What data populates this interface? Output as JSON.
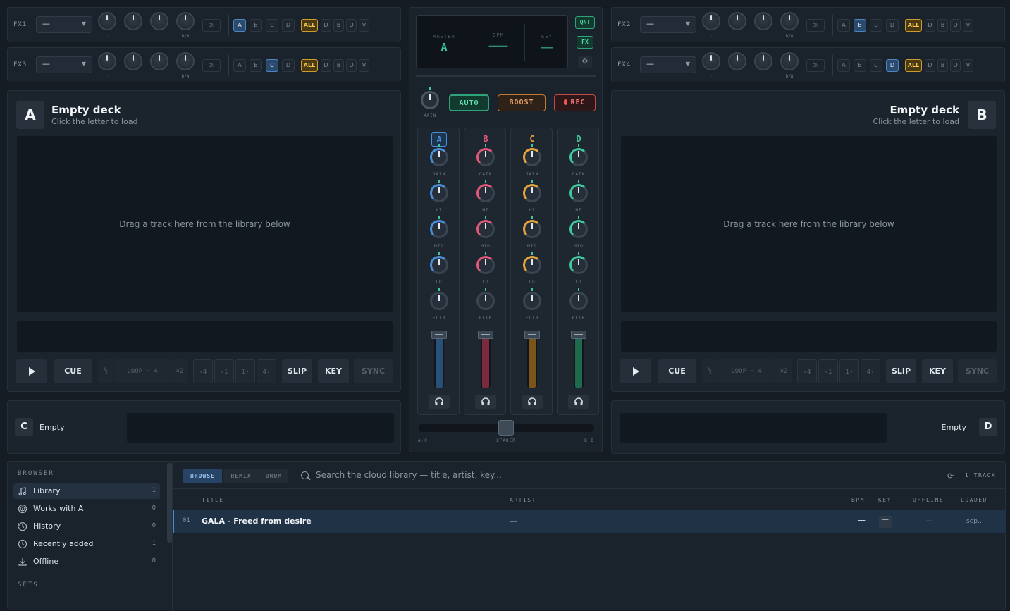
{
  "fx_units": [
    {
      "name": "FX1",
      "effect": "—",
      "mix_label": "D/W",
      "on_label": "ON",
      "channels": [
        "A",
        "B",
        "C",
        "D"
      ],
      "selected": "A",
      "all_label": "ALL",
      "outputs": [
        "D",
        "B",
        "O",
        "V"
      ]
    },
    {
      "name": "FX3",
      "effect": "—",
      "mix_label": "D/W",
      "on_label": "ON",
      "channels": [
        "A",
        "B",
        "C",
        "D"
      ],
      "selected": "C",
      "all_label": "ALL",
      "outputs": [
        "D",
        "B",
        "O",
        "V"
      ]
    },
    {
      "name": "FX2",
      "effect": "—",
      "mix_label": "D/W",
      "on_label": "ON",
      "channels": [
        "A",
        "B",
        "C",
        "D"
      ],
      "selected": "B",
      "all_label": "ALL",
      "outputs": [
        "D",
        "B",
        "O",
        "V"
      ]
    },
    {
      "name": "FX4",
      "effect": "—",
      "mix_label": "D/W",
      "on_label": "ON",
      "channels": [
        "A",
        "B",
        "C",
        "D"
      ],
      "selected": "D",
      "all_label": "ALL",
      "outputs": [
        "D",
        "B",
        "O",
        "V"
      ]
    }
  ],
  "deck_a": {
    "letter": "A",
    "title": "Empty deck",
    "subtitle": "Click the letter to load",
    "drop_hint": "Drag a track here from the library below"
  },
  "deck_b": {
    "letter": "B",
    "title": "Empty deck",
    "subtitle": "Click the letter to load",
    "drop_hint": "Drag a track here from the library below"
  },
  "transport": {
    "cue": "CUE",
    "loop_label": "LOOP",
    "loop_size": "4",
    "halve": "½",
    "double": "×2",
    "jump_back4": "‹4",
    "jump_back1": "‹1",
    "jump_fwd1": "1›",
    "jump_fwd4": "4›",
    "slip": "SLIP",
    "key": "KEY",
    "sync": "SYNC"
  },
  "deck_c": {
    "letter": "C",
    "label": "Empty"
  },
  "deck_d": {
    "letter": "D",
    "label": "Empty"
  },
  "mixer": {
    "display": {
      "master_label": "MASTER",
      "master_value": "A",
      "bpm_label": "BPM",
      "bpm_value": "———",
      "key_label": "KEY",
      "key_value": "——"
    },
    "qnt": "QNT",
    "fx": "FX",
    "main_label": "MAIN",
    "auto": "AUTO",
    "boost": "BOOST",
    "rec": "REC",
    "channels": [
      {
        "letter": "A",
        "color": "#4a8fd9",
        "fill": "#27507a"
      },
      {
        "letter": "B",
        "color": "#e0587a",
        "fill": "#7a2a3c"
      },
      {
        "letter": "C",
        "color": "#e6a53a",
        "fill": "#7a5418"
      },
      {
        "letter": "D",
        "color": "#3ec79a",
        "fill": "#1e6a4c"
      }
    ],
    "knob_labels": [
      "GAIN",
      "HI",
      "MID",
      "LO",
      "FLTR"
    ],
    "xfader_left": "A·C",
    "xfader_label": "XFADER",
    "xfader_right": "B·D"
  },
  "browser": {
    "heading": "BROWSER",
    "items": [
      {
        "label": "Library",
        "count": "1",
        "icon": "music-note-icon"
      },
      {
        "label": "Works with A",
        "count": "0",
        "icon": "target-icon"
      },
      {
        "label": "History",
        "count": "0",
        "icon": "history-icon"
      },
      {
        "label": "Recently added",
        "count": "1",
        "icon": "clock-icon"
      },
      {
        "label": "Offline",
        "count": "0",
        "icon": "download-icon"
      }
    ],
    "sets_heading": "SETS",
    "tabs": [
      "BROWSE",
      "REMIX",
      "DRUM"
    ],
    "search_placeholder": "Search the cloud library — title, artist, key...",
    "track_count": "1 TRACK",
    "columns": {
      "title": "TITLE",
      "artist": "ARTIST",
      "bpm": "BPM",
      "key": "KEY",
      "offline": "OFFLINE",
      "loaded": "LOADED"
    },
    "rows": [
      {
        "index": "01",
        "title": "GALA - Freed from desire",
        "artist": "—",
        "bpm": "—",
        "key": "—",
        "offline": "—",
        "loaded": "sep…"
      }
    ]
  }
}
